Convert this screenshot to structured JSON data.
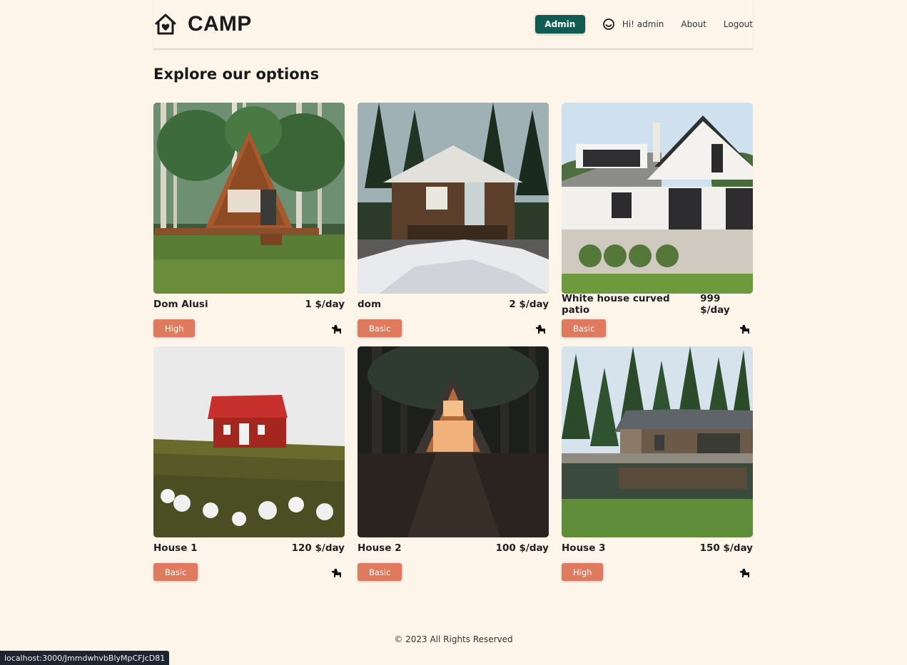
{
  "header": {
    "brand": "CAMP",
    "admin_label": "Admin",
    "greeting": "Hi! admin",
    "about_label": "About",
    "logout_label": "Logout"
  },
  "main": {
    "title": "Explore our options",
    "listings": [
      {
        "name": "Dom Alusi",
        "price": "1 $/day",
        "tier": "High",
        "pet_icon": "dog-icon",
        "image": "a-frame wooden cabin in aspen forest"
      },
      {
        "name": "dom",
        "price": "2 $/day",
        "tier": "Basic",
        "pet_icon": "dog-icon",
        "image": "log cabin with snow in pine forest"
      },
      {
        "name": "White house curved patio",
        "price": "999 $/day",
        "tier": "Basic",
        "pet_icon": "dog-icon",
        "image": "white farmhouse with stone patio"
      },
      {
        "name": "House 1",
        "price": "120 $/day",
        "tier": "Basic",
        "pet_icon": "dog-icon",
        "image": "small red cabin on grassy hill"
      },
      {
        "name": "House 2",
        "price": "100 $/day",
        "tier": "Basic",
        "pet_icon": "dog-icon",
        "image": "lit a-frame cabin in dark forest"
      },
      {
        "name": "House 3",
        "price": "150 $/day",
        "tier": "High",
        "pet_icon": "dog-icon",
        "image": "lake house among pine trees"
      }
    ]
  },
  "footer": {
    "text": "© 2023 All Rights Reserved"
  },
  "status_bar": {
    "url": "localhost:3000/JmmdwhvbBlyMpCFJcD81"
  },
  "colors": {
    "background": "#fdf5ea",
    "admin_button": "#0f5c52",
    "badge": "#e07a5f",
    "text": "#1f1f1f"
  }
}
